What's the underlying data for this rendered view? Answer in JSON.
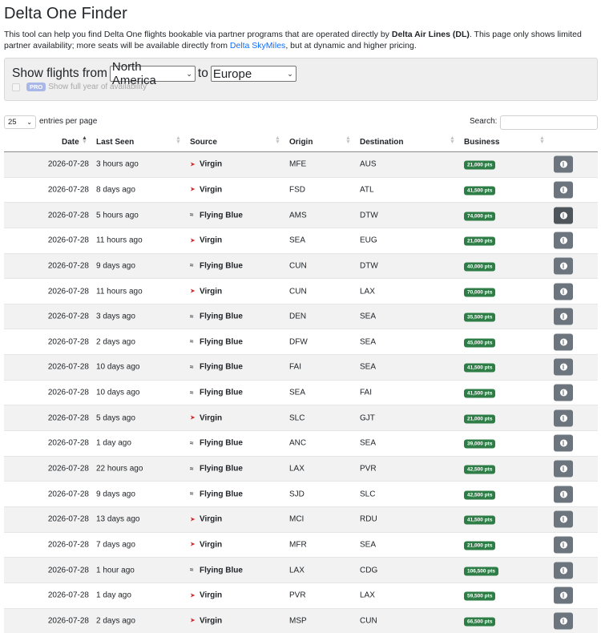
{
  "page": {
    "title": "Delta One Finder",
    "intro_1": "This tool can help you find Delta One flights bookable via partner programs that are operated directly by ",
    "intro_bold": "Delta Air Lines (DL)",
    "intro_2": ". This page only shows limited partner availability; more seats will be available directly from ",
    "intro_link": "Delta SkyMiles",
    "intro_3": ", but at dynamic and higher pricing."
  },
  "filter": {
    "show_from": "Show flights from",
    "from_value": "North America",
    "to_word": "to",
    "to_value": "Europe",
    "pro_badge": "PRO",
    "pro_label": "Show full year of availability"
  },
  "table_controls": {
    "entries_value": "25",
    "entries_label": "entries per page",
    "search_label": "Search:",
    "search_value": ""
  },
  "columns": {
    "date": "Date",
    "last_seen": "Last Seen",
    "source": "Source",
    "origin": "Origin",
    "destination": "Destination",
    "business": "Business"
  },
  "icons": {
    "virgin": "virgin-logo-icon",
    "flying_blue": "flying-blue-logo-icon",
    "info": "info-icon"
  },
  "colors": {
    "points_badge": "#2e7d46",
    "info_button": "#6c757d",
    "link": "#0d6efd",
    "virgin_red": "#d6262e"
  },
  "rows": [
    {
      "date": "2026-07-28",
      "last_seen": "3 hours ago",
      "source": "Virgin",
      "origin": "MFE",
      "destination": "AUS",
      "business": "21,000 pts"
    },
    {
      "date": "2026-07-28",
      "last_seen": "8 days ago",
      "source": "Virgin",
      "origin": "FSD",
      "destination": "ATL",
      "business": "41,500 pts"
    },
    {
      "date": "2026-07-28",
      "last_seen": "5 hours ago",
      "source": "Flying Blue",
      "origin": "AMS",
      "destination": "DTW",
      "business": "74,000 pts"
    },
    {
      "date": "2026-07-28",
      "last_seen": "11 hours ago",
      "source": "Virgin",
      "origin": "SEA",
      "destination": "EUG",
      "business": "21,000 pts"
    },
    {
      "date": "2026-07-28",
      "last_seen": "9 days ago",
      "source": "Flying Blue",
      "origin": "CUN",
      "destination": "DTW",
      "business": "40,000 pts"
    },
    {
      "date": "2026-07-28",
      "last_seen": "11 hours ago",
      "source": "Virgin",
      "origin": "CUN",
      "destination": "LAX",
      "business": "70,000 pts"
    },
    {
      "date": "2026-07-28",
      "last_seen": "3 days ago",
      "source": "Flying Blue",
      "origin": "DEN",
      "destination": "SEA",
      "business": "35,500 pts"
    },
    {
      "date": "2026-07-28",
      "last_seen": "2 days ago",
      "source": "Flying Blue",
      "origin": "DFW",
      "destination": "SEA",
      "business": "45,000 pts"
    },
    {
      "date": "2026-07-28",
      "last_seen": "10 days ago",
      "source": "Flying Blue",
      "origin": "FAI",
      "destination": "SEA",
      "business": "41,500 pts"
    },
    {
      "date": "2026-07-28",
      "last_seen": "10 days ago",
      "source": "Flying Blue",
      "origin": "SEA",
      "destination": "FAI",
      "business": "41,500 pts"
    },
    {
      "date": "2026-07-28",
      "last_seen": "5 days ago",
      "source": "Virgin",
      "origin": "SLC",
      "destination": "GJT",
      "business": "21,000 pts"
    },
    {
      "date": "2026-07-28",
      "last_seen": "1 day ago",
      "source": "Flying Blue",
      "origin": "ANC",
      "destination": "SEA",
      "business": "39,000 pts"
    },
    {
      "date": "2026-07-28",
      "last_seen": "22 hours ago",
      "source": "Flying Blue",
      "origin": "LAX",
      "destination": "PVR",
      "business": "42,500 pts"
    },
    {
      "date": "2026-07-28",
      "last_seen": "9 days ago",
      "source": "Flying Blue",
      "origin": "SJD",
      "destination": "SLC",
      "business": "42,500 pts"
    },
    {
      "date": "2026-07-28",
      "last_seen": "13 days ago",
      "source": "Virgin",
      "origin": "MCI",
      "destination": "RDU",
      "business": "41,500 pts"
    },
    {
      "date": "2026-07-28",
      "last_seen": "7 days ago",
      "source": "Virgin",
      "origin": "MFR",
      "destination": "SEA",
      "business": "21,000 pts"
    },
    {
      "date": "2026-07-28",
      "last_seen": "1 hour ago",
      "source": "Flying Blue",
      "origin": "LAX",
      "destination": "CDG",
      "business": "106,500 pts"
    },
    {
      "date": "2026-07-28",
      "last_seen": "1 day ago",
      "source": "Virgin",
      "origin": "PVR",
      "destination": "LAX",
      "business": "59,500 pts"
    },
    {
      "date": "2026-07-28",
      "last_seen": "2 days ago",
      "source": "Virgin",
      "origin": "MSP",
      "destination": "CUN",
      "business": "66,500 pts"
    }
  ]
}
